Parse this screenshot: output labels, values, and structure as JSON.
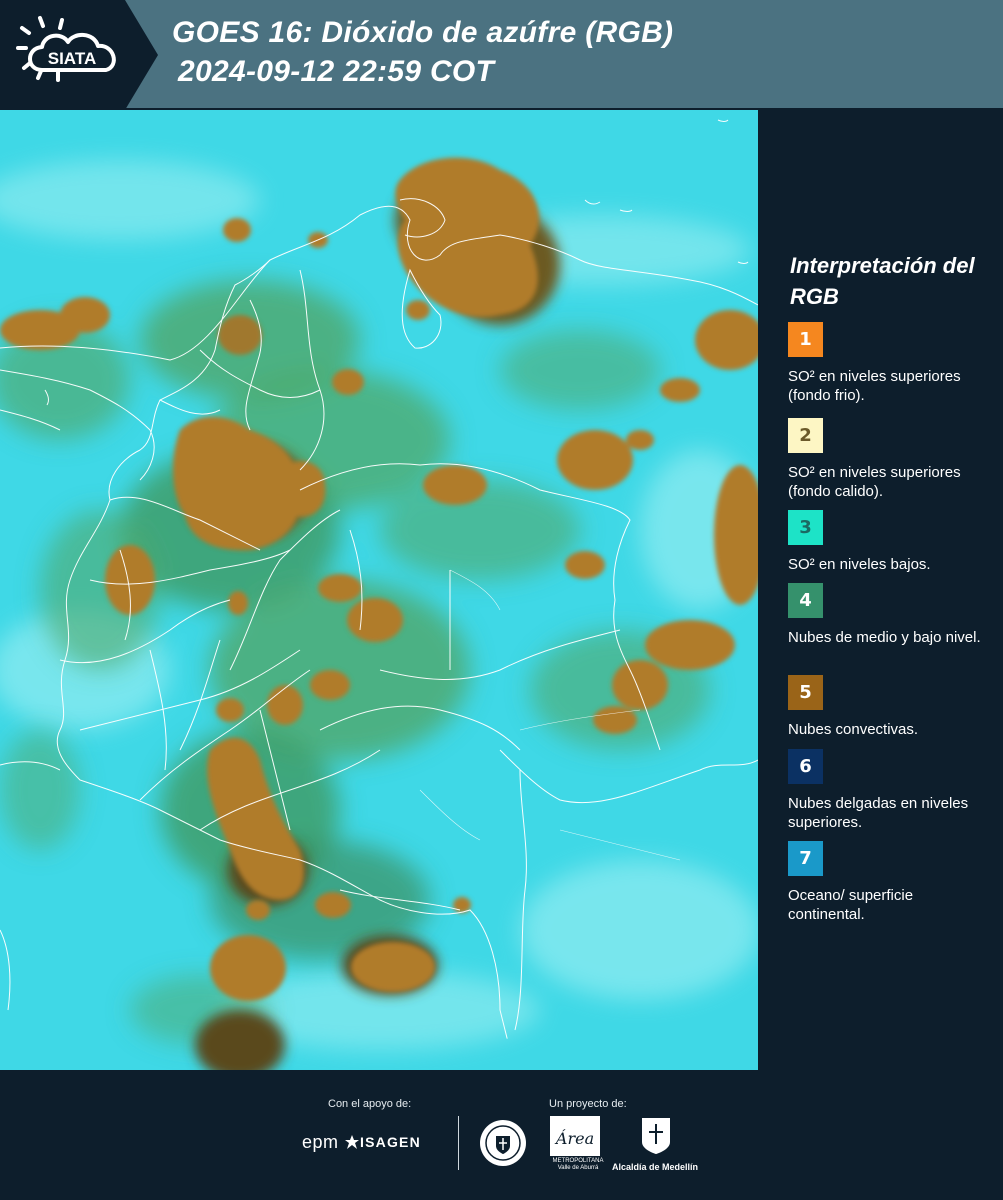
{
  "header": {
    "logo_text": "SIATA",
    "title_line1": "GOES 16: Dióxido de azúfre (RGB)",
    "title_line2": "2024-09-12 22:59 COT"
  },
  "legend": {
    "title": "Interpretación del RGB",
    "items": [
      {
        "number": "1",
        "label": "SO² en niveles superiores (fondo frio).",
        "color": "#f5871f",
        "text_color": "#ffffff"
      },
      {
        "number": "2",
        "label": "SO² en niveles superiores (fondo calido).",
        "color": "#fdf6c4",
        "text_color": "#6b5a2a"
      },
      {
        "number": "3",
        "label": "SO² en niveles bajos.",
        "color": "#1de3c7",
        "text_color": "#1b6a63"
      },
      {
        "number": "4",
        "label": "Nubes de medio y bajo nivel.",
        "color": "#35916c",
        "text_color": "#ffffff"
      },
      {
        "number": "5",
        "label": "Nubes convectivas.",
        "color": "#9a6418",
        "text_color": "#ffffff"
      },
      {
        "number": "6",
        "label": "Nubes delgadas en niveles superiores.",
        "color": "#0b3163",
        "text_color": "#ffffff"
      },
      {
        "number": "7",
        "label": "Oceano/ superficie continental.",
        "color": "#1a99c9",
        "text_color": "#ffffff"
      }
    ]
  },
  "footer": {
    "support_caption": "Con el apoyo de:",
    "project_caption": "Un proyecto de:",
    "epm": "epm",
    "isagen": "ISAGEN",
    "area_name": "Área",
    "area_caption": "METROPOLITANA Valle de Aburrá",
    "alcaldia": "Alcaldía de Medellín"
  },
  "colors": {
    "header_bg": "#4b7281",
    "dark_bg": "#0d1e2c",
    "map_background": "#3fd8e6",
    "convective_cloud": "#b07c2a",
    "mid_low_cloud": "#4fa86a"
  }
}
